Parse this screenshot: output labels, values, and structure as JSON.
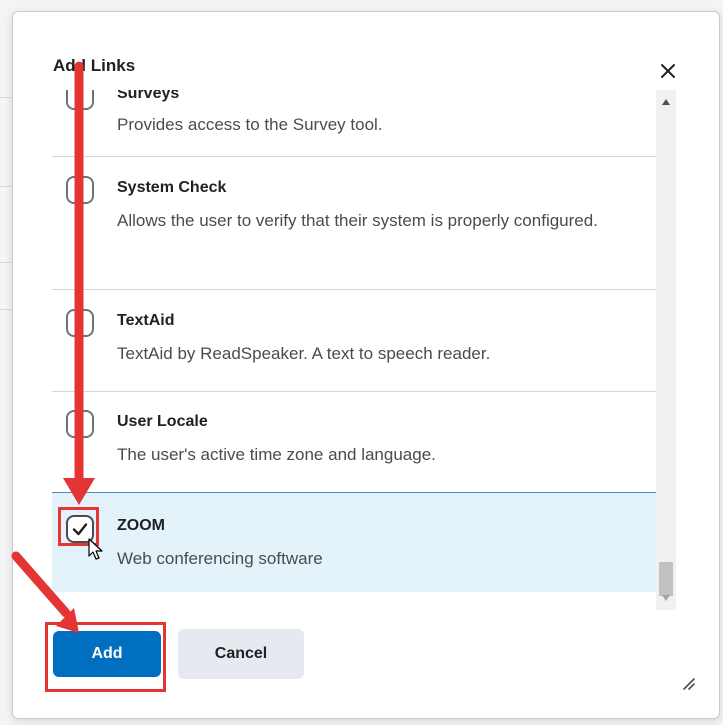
{
  "dialog": {
    "title": "Add Links",
    "close_label": "Close"
  },
  "items": [
    {
      "title": "Surveys",
      "description": "Provides access to the Survey tool.",
      "checked": false
    },
    {
      "title": "System Check",
      "description": "Allows the user to verify that their system is properly configured.",
      "checked": false
    },
    {
      "title": "TextAid",
      "description": "TextAid by ReadSpeaker. A text to speech reader.",
      "checked": false
    },
    {
      "title": "User Locale",
      "description": "The user's active time zone and language.",
      "checked": false
    },
    {
      "title": "ZOOM",
      "description": "Web conferencing software",
      "checked": true
    }
  ],
  "buttons": {
    "add_label": "Add",
    "cancel_label": "Cancel"
  },
  "colors": {
    "primary": "#006fbf",
    "selected_row": "#e4f2fa",
    "annotation": "#e53434"
  },
  "icons": {
    "close": "close-icon",
    "check": "check-icon",
    "resize": "resize-handle-icon",
    "cursor": "pointer-cursor-icon"
  }
}
